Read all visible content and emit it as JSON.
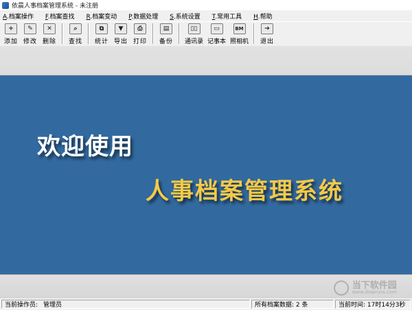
{
  "window": {
    "title": "依晨人事档案管理系统 - 未注册"
  },
  "menu": [
    {
      "key": "A",
      "label": ".档案操作"
    },
    {
      "key": "F",
      "label": ".档案查找"
    },
    {
      "key": "R",
      "label": ".档案变动"
    },
    {
      "key": "P",
      "label": ".数据处理"
    },
    {
      "key": "S",
      "label": ".系统设置"
    },
    {
      "key": "T",
      "label": ".常用工具"
    },
    {
      "key": "H",
      "label": ".帮助"
    }
  ],
  "toolbar": {
    "add": {
      "label": "添加",
      "icon": "add-icon",
      "glyph": "+"
    },
    "edit": {
      "label": "修改",
      "icon": "pencil-icon",
      "glyph": "✎"
    },
    "delete": {
      "label": "删除",
      "icon": "delete-x-icon",
      "glyph": "✕"
    },
    "find": {
      "label": "查找",
      "icon": "magnifier-icon",
      "glyph": "⌕"
    },
    "stats": {
      "label": "统计",
      "icon": "copy-pages-icon",
      "glyph": "⧉"
    },
    "export": {
      "label": "导出",
      "icon": "export-down-icon",
      "glyph": "▼"
    },
    "print": {
      "label": "打印",
      "icon": "printer-icon",
      "glyph": "⎙"
    },
    "backup": {
      "label": "备份",
      "icon": "backup-disk-icon",
      "glyph": "▤"
    },
    "contacts": {
      "label": "通讯录",
      "icon": "address-book-icon",
      "glyph": "▯▯"
    },
    "notepad": {
      "label": "记事本",
      "icon": "notepad-icon",
      "glyph": "▭"
    },
    "photo": {
      "label": "照相机",
      "icon": "camera-bm-icon",
      "glyph": "BM"
    },
    "exit": {
      "label": "退出",
      "icon": "exit-arrow-icon",
      "glyph": "➔"
    }
  },
  "welcome": {
    "line1": "欢迎使用",
    "line2": "人事档案管理系统"
  },
  "watermark": {
    "main": "当下软件园",
    "sub": "www.downxia.com"
  },
  "status": {
    "operator_label": "当前操作员:",
    "operator_value": "管理员",
    "record_count": "所有档案数据: 2 条",
    "current_time": "当前时间: 17时14分3秒"
  },
  "colors": {
    "welcome_bg": "#326aa0",
    "line1_color": "#ffffff",
    "line2_color": "#f6c948"
  }
}
